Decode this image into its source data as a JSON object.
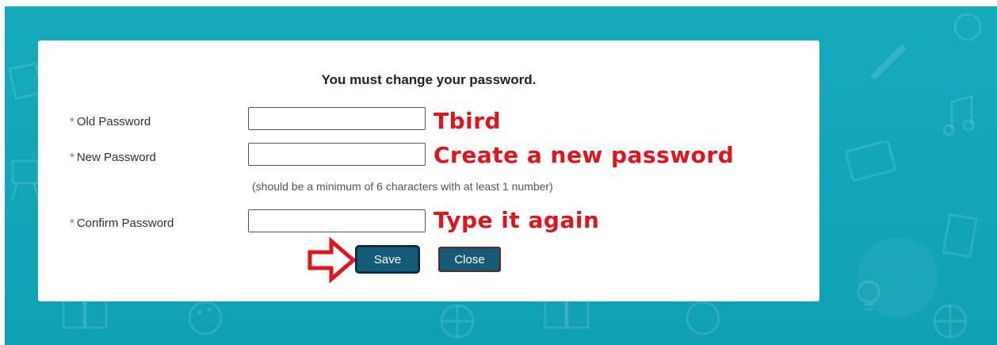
{
  "colors": {
    "background": "#12a5b8",
    "button": "#145b78",
    "annotation": "#e3131b",
    "required_star": "#d9534f"
  },
  "dialog": {
    "title": "You must change your password.",
    "required_marker": "*",
    "fields": [
      {
        "label": "Old Password",
        "value": "",
        "annotation": "Tbird"
      },
      {
        "label": "New Password",
        "value": "",
        "annotation": "Create a new password"
      },
      {
        "label": "Confirm Password",
        "value": "",
        "annotation": "Type it again"
      }
    ],
    "password_hint": "(should be a minimum of 6 characters with at least 1 number)",
    "save_label": "Save",
    "close_label": "Close"
  },
  "icons": {
    "pointer_arrow": "red-outline-arrow-right",
    "background_pattern": "education-doodles"
  }
}
